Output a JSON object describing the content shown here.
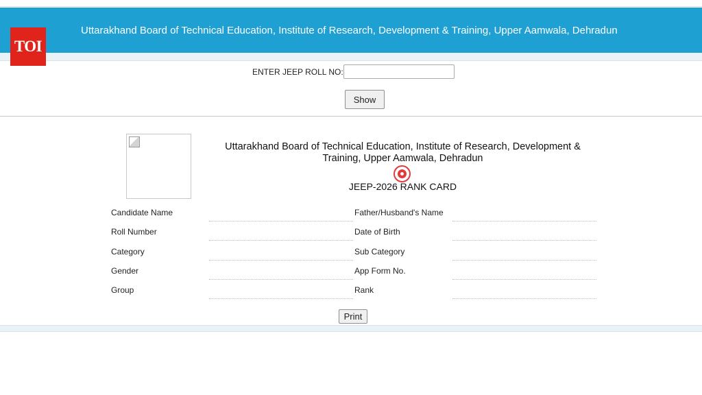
{
  "header": {
    "title": "Uttarakhand Board of Technical Education, Institute of Research, Development & Training, Upper Aamwala, Dehradun",
    "logo_text": "TOI",
    "logo_color": "#e1241b",
    "banner_color": "#1ea0d3"
  },
  "search": {
    "label": "ENTER JEEP ROLL NO:",
    "required_mark": "*",
    "value": "",
    "placeholder": "",
    "show_label": "Show"
  },
  "card": {
    "title_line1": "Uttarakhand Board of Technical Education, Institute of Research, Development &",
    "title_line2": "Training, Upper Aamwala, Dehradun",
    "emblem_icon": "board-emblem-icon",
    "rank_card_title": "JEEP-2026 RANK CARD",
    "photo_icon": "broken-image-icon",
    "fields_left": [
      {
        "label": "Candidate Name",
        "value": ""
      },
      {
        "label": "Roll Number",
        "value": ""
      },
      {
        "label": "Category",
        "value": ""
      },
      {
        "label": "Gender",
        "value": ""
      },
      {
        "label": "Group",
        "value": ""
      }
    ],
    "fields_right": [
      {
        "label": "Father/Husband's Name",
        "value": ""
      },
      {
        "label": "Date of Birth",
        "value": ""
      },
      {
        "label": "Sub Category",
        "value": ""
      },
      {
        "label": "App Form No.",
        "value": ""
      },
      {
        "label": "Rank",
        "value": ""
      }
    ],
    "print_label": "Print"
  }
}
